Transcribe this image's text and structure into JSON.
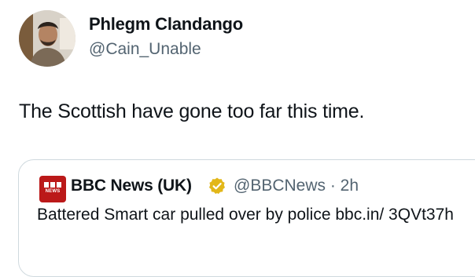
{
  "author": {
    "display_name": "Phlegm Clandango",
    "handle": "@Cain_Unable"
  },
  "tweet_text": "The Scottish have gone too far this time.",
  "quoted_tweet": {
    "logo_text": "NEWS",
    "display_name": "BBC News (UK)",
    "handle_time": "@BBCNews · 2h",
    "text": "Battered Smart car pulled over by police bbc.in/ 3QVt37h",
    "verified_badge": "gold-verified-badge-icon"
  },
  "colors": {
    "text": "#0f1419",
    "secondary_text": "#536471",
    "border": "#cfd9de",
    "bbc_red": "#bb1919",
    "verified_gold": "#e2b719"
  }
}
